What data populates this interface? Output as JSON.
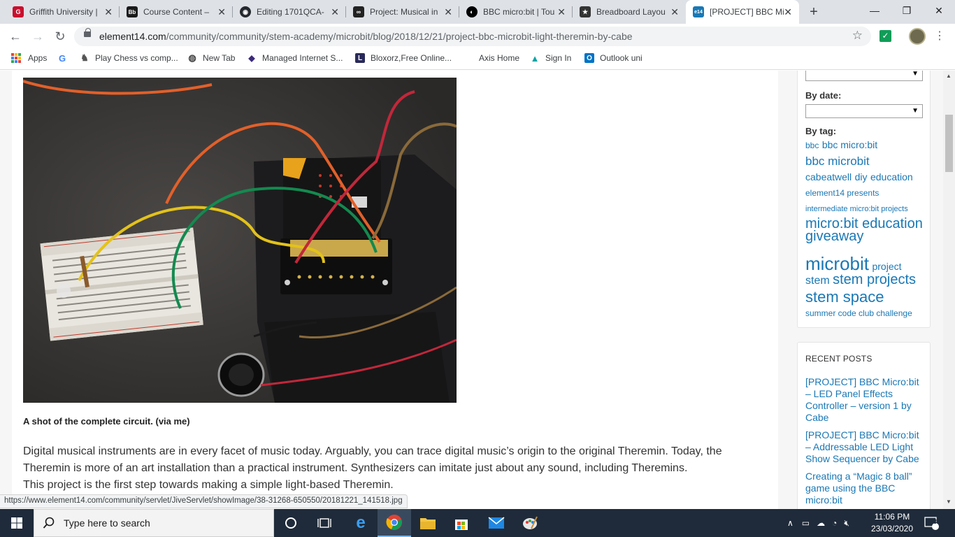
{
  "browser": {
    "tabs": [
      {
        "label": "Griffith University |",
        "icon": "griffith-icon",
        "color": "#c8102e",
        "glyph": "G"
      },
      {
        "label": "Course Content –",
        "icon": "blackboard-icon",
        "color": "#1a1a1a",
        "glyph": "Bb"
      },
      {
        "label": "Editing 1701QCA-",
        "icon": "github-icon",
        "color": "#24292e",
        "glyph": "◉"
      },
      {
        "label": "Project: Musical in",
        "icon": "instructables-icon",
        "color": "#222222",
        "glyph": "∞"
      },
      {
        "label": "BBC micro:bit | Tou",
        "icon": "bbc-icon",
        "color": "#000000",
        "glyph": "◐"
      },
      {
        "label": "Breadboard Layou",
        "icon": "star-icon",
        "color": "#333333",
        "glyph": "★"
      },
      {
        "label": "[PROJECT] BBC Mi",
        "icon": "element14-icon",
        "color": "#1a78b5",
        "glyph": "e14",
        "active": true
      }
    ],
    "new_tab": "+",
    "window_controls": {
      "minimize": "—",
      "maximize": "❐",
      "close": "✕"
    },
    "url_host": "element14.com",
    "url_path": "/community/community/stem-academy/microbit/blog/2018/12/21/project-bbc-microbit-light-theremin-by-cabe",
    "bookmarks": [
      {
        "label": "Apps",
        "icon": "apps-grid-icon"
      },
      {
        "label": "",
        "icon": "google-icon",
        "glyph": "G",
        "color": "#4285f4"
      },
      {
        "label": "Play Chess vs comp...",
        "icon": "chess-icon",
        "glyph": "♞",
        "color": "#333333"
      },
      {
        "label": "New Tab",
        "icon": "globe-icon",
        "glyph": "◍",
        "color": "#333333"
      },
      {
        "label": "Managed Internet S...",
        "icon": "shield-icon",
        "glyph": "◆",
        "color": "#3b2a7a"
      },
      {
        "label": "Bloxorz,Free Online...",
        "icon": "bloxorz-icon",
        "glyph": "L",
        "color": "#2a2a5a"
      },
      {
        "label": "Axis Home",
        "icon": "axis-icon",
        "glyph": "",
        "color": "#ffffff"
      },
      {
        "label": "Sign In",
        "icon": "signin-icon",
        "glyph": "▲",
        "color": "#0078d4"
      },
      {
        "label": "Outlook uni",
        "icon": "outlook-icon",
        "glyph": "O",
        "color": "#0072c6"
      }
    ]
  },
  "article": {
    "caption": "A shot of the complete circuit. (via me)",
    "paragraph_lines": [
      "Digital musical instruments are in every facet of music today. Arguably, you can trace digital music’s origin to the original Theremin. Today, the",
      "Theremin is more of an art installation than a practical instrument. Synthesizers can imitate just about any sound, including Theremins.",
      "This project is the first step towards making a simple light-based Theremin."
    ]
  },
  "sidebar": {
    "by_date_label": "By date:",
    "by_tag_label": "By tag:",
    "tags": [
      {
        "text": "bbc",
        "size": 12
      },
      {
        "text": "bbc micro:bit",
        "size": 14
      },
      {
        "text": "bbc microbit",
        "size": 17
      },
      {
        "text": "cabeatwell",
        "size": 14
      },
      {
        "text": "diy",
        "size": 14
      },
      {
        "text": "education",
        "size": 14
      },
      {
        "text": "element14 presents",
        "size": 12
      },
      {
        "text": "intermediate micro:bit projects",
        "size": 12
      },
      {
        "text": "micro:bit education giveaway",
        "size": 21
      },
      {
        "text": "microbit",
        "size": 27
      },
      {
        "text": "project",
        "size": 15
      },
      {
        "text": "stem",
        "size": 17
      },
      {
        "text": "stem projects",
        "size": 21
      },
      {
        "text": "stem space",
        "size": 23
      },
      {
        "text": "summer code club challenge",
        "size": 12
      }
    ],
    "recent_posts_title": "RECENT POSTS",
    "recent_posts": [
      "[PROJECT] BBC Micro:bit – LED Panel Effects Controller – version 1 by Cabe",
      "[PROJECT] BBC Micro:bit – Addressable LED Light Show Sequencer by Cabe",
      "Creating a “Magic 8 ball” game using the BBC micro:bit"
    ]
  },
  "status_url": "https://www.element14.com/community/servlet/JiveServlet/showImage/38-31268-650550/20181221_141518.jpg",
  "taskbar": {
    "search_placeholder": "Type here to search",
    "time": "11:06 PM",
    "date": "23/03/2020",
    "notifications": "3"
  },
  "colors": {
    "link": "#1a78b5",
    "taskbar": "#1f2b3a"
  }
}
